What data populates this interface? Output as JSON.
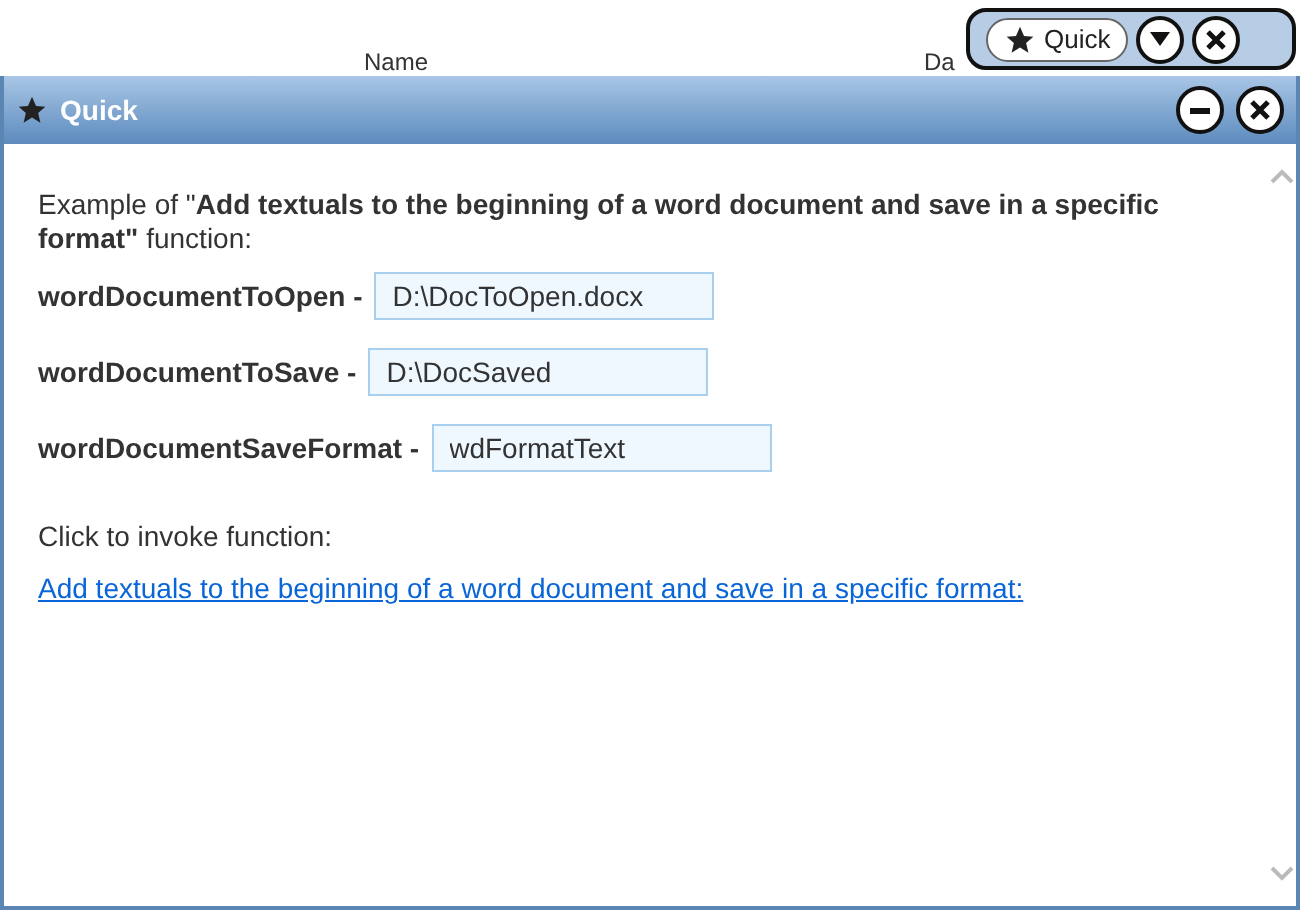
{
  "background_explorer": {
    "columns": [
      "Name",
      "Da"
    ]
  },
  "mini_toolbar": {
    "button": "Quick"
  },
  "window": {
    "title": "Quick"
  },
  "intro": "Example of \"**Add textuals to the beginning of a word document and save in a specific format\"** function:",
  "params": [
    {
      "label": "wordDocumentToOpen -",
      "value": "D:\\DocToOpen.docx"
    },
    {
      "label": "wordDocumentToSave -",
      "value": "D:\\DocSaved"
    },
    {
      "label": "wordDocumentSaveFormat -",
      "value": "wdFormatText"
    }
  ],
  "invoke_label": "Click to invoke function:",
  "invoke_link": "Add textuals to the beginning of a word document and save in a specific format:"
}
